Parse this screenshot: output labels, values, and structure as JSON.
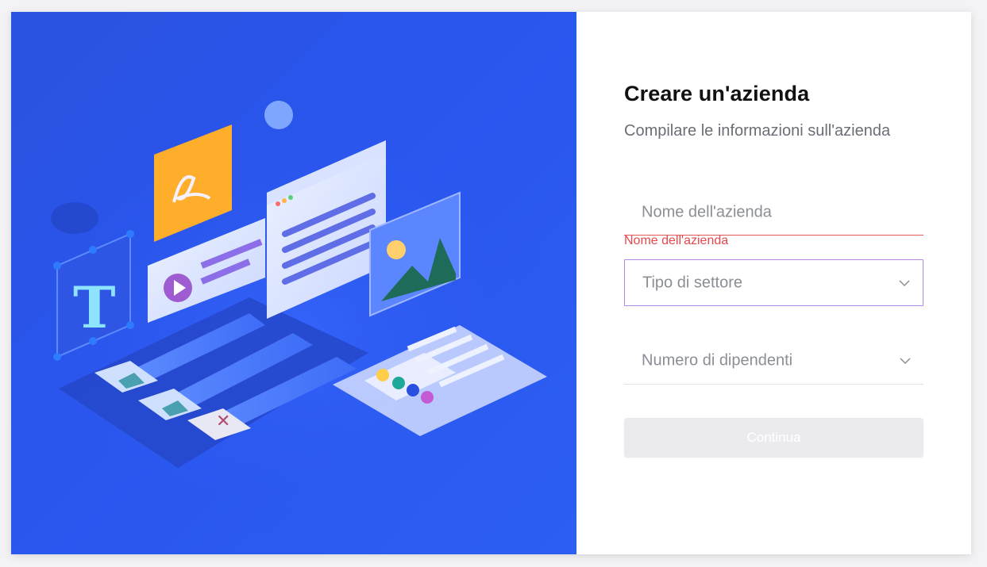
{
  "form": {
    "title": "Creare un'azienda",
    "subtitle": "Compilare le informazioni sull'azienda",
    "company_name": {
      "placeholder": "Nome dell'azienda",
      "value": "",
      "error": "Nome dell'azienda"
    },
    "sector_select": {
      "placeholder": "Tipo di settore"
    },
    "employees_select": {
      "placeholder": "Numero di dipendenti"
    },
    "continue_label": "Continua"
  },
  "colors": {
    "hero_blue": "#2a56ee",
    "error_red": "#e5484d",
    "focus_purple": "#b58ae6",
    "button_disabled": "#ebebee"
  },
  "icons": [
    "chevron-down-icon",
    "chevron-down-icon"
  ]
}
